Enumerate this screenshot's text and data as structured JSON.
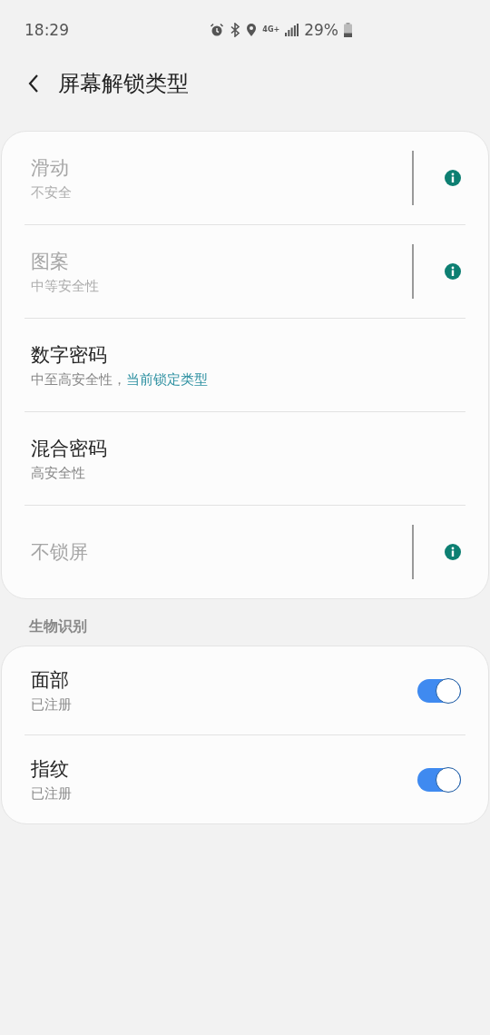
{
  "status_bar": {
    "time": "18:29",
    "network_type": "4G+",
    "battery": "29%"
  },
  "header": {
    "title": "屏幕解锁类型"
  },
  "lock_types": [
    {
      "title": "滑动",
      "subtitle": "不安全",
      "disabled": true,
      "info": true
    },
    {
      "title": "图案",
      "subtitle": "中等安全性",
      "disabled": true,
      "info": true
    },
    {
      "title": "数字密码",
      "subtitle": "中至高安全性，",
      "note": "当前锁定类型",
      "disabled": false,
      "info": false
    },
    {
      "title": "混合密码",
      "subtitle": "高安全性",
      "disabled": false,
      "info": false
    },
    {
      "title": "不锁屏",
      "disabled": true,
      "info": true
    }
  ],
  "biometrics": {
    "heading": "生物识别",
    "items": [
      {
        "title": "面部",
        "subtitle": "已注册",
        "on": true
      },
      {
        "title": "指纹",
        "subtitle": "已注册",
        "on": true
      }
    ]
  }
}
